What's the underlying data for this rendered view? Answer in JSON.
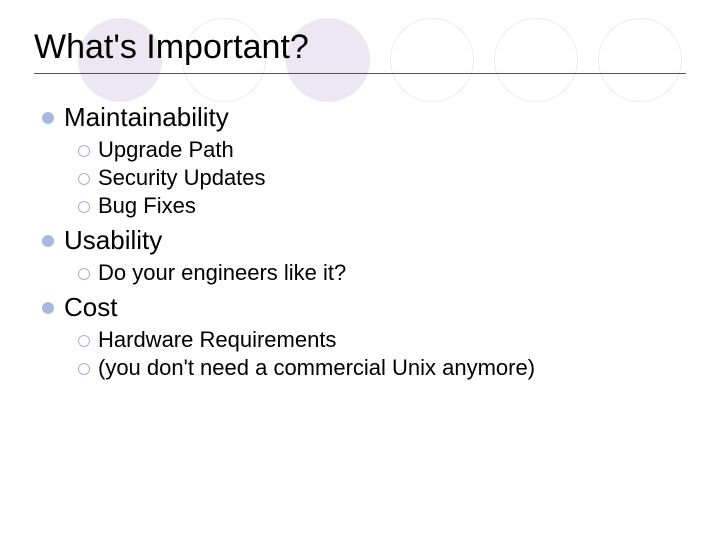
{
  "title": "What's Important?",
  "sections": [
    {
      "heading": "Maintainability",
      "items": [
        "Upgrade Path",
        "Security Updates",
        "Bug Fixes"
      ]
    },
    {
      "heading": "Usability",
      "items": [
        "Do your engineers like it?"
      ]
    },
    {
      "heading": "Cost",
      "items": [
        "Hardware Requirements",
        "(you don't need a commercial Unix anymore)"
      ]
    }
  ]
}
